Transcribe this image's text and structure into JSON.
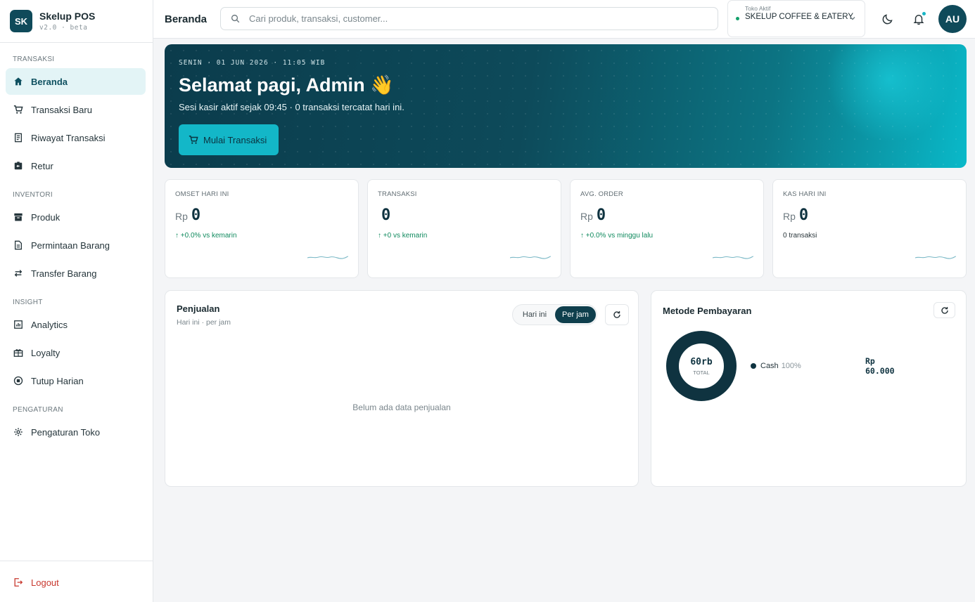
{
  "brand": {
    "initials": "SK",
    "name": "Skelup POS",
    "version": "v2.0 · beta"
  },
  "sidebar": {
    "sections": [
      {
        "title": "TRANSAKSI"
      },
      {
        "title": "INVENTORI"
      },
      {
        "title": "INSIGHT"
      },
      {
        "title": "PENGATURAN"
      }
    ],
    "items": [
      {
        "label": "Beranda",
        "icon": "home-icon",
        "active": true
      },
      {
        "label": "Transaksi Baru",
        "icon": "cart-icon"
      },
      {
        "label": "Riwayat Transaksi",
        "icon": "receipt-icon"
      },
      {
        "label": "Retur",
        "icon": "return-box-icon"
      },
      {
        "label": "Produk",
        "icon": "archive-box-icon"
      },
      {
        "label": "Permintaan Barang",
        "icon": "document-icon"
      },
      {
        "label": "Transfer Barang",
        "icon": "transfer-arrows-icon"
      },
      {
        "label": "Analytics",
        "icon": "bar-chart-icon"
      },
      {
        "label": "Loyalty",
        "icon": "gift-icon"
      },
      {
        "label": "Tutup Harian",
        "icon": "stop-circle-icon"
      },
      {
        "label": "Pengaturan Toko",
        "icon": "gear-icon"
      }
    ],
    "logout_label": "Logout"
  },
  "header": {
    "title": "Beranda",
    "search_placeholder": "Cari produk, transaksi, customer...",
    "store_label": "Toko Aktif",
    "store_name": "SKELUP COFFEE & EATERY",
    "avatar_initials": "AU"
  },
  "hero": {
    "date": "SENIN · 01 JUN 2026 · 11:05 WIB",
    "title": "Selamat pagi, Admin 👋",
    "subtitle": "Sesi kasir aktif sejak 09:45 · 0 transaksi tercatat hari ini.",
    "button_label": "Mulai Transaksi"
  },
  "stats": [
    {
      "label": "OMSET HARI INI",
      "currency": "Rp",
      "value": "0",
      "delta": "+0.0% vs kemarin",
      "trend": "up"
    },
    {
      "label": "TRANSAKSI",
      "currency": "",
      "value": "0",
      "delta": "+0 vs kemarin",
      "trend": "up"
    },
    {
      "label": "AVG. ORDER",
      "currency": "Rp",
      "value": "0",
      "delta": "+0.0% vs minggu lalu",
      "trend": "up"
    },
    {
      "label": "KAS HARI INI",
      "currency": "Rp",
      "value": "0",
      "delta": "0 transaksi",
      "trend": "none"
    }
  ],
  "sales": {
    "title": "Penjualan",
    "subtitle": "Hari ini · per jam",
    "toggle_options": [
      "Hari ini",
      "Per jam"
    ],
    "selected": "Per jam",
    "empty_text": "Belum ada data penjualan"
  },
  "payment": {
    "title": "Metode Pembayaran",
    "total_value": "60rb",
    "total_label": "TOTAL",
    "methods": [
      {
        "name": "Cash",
        "percent": "100%",
        "share": 1.0,
        "amount": "Rp 60.000",
        "color": "#0f3340"
      }
    ]
  },
  "colors": {
    "accent": "#13b7c8",
    "primary_dark": "#0f3f4d",
    "positive": "#108a5e",
    "danger": "#c8382e"
  }
}
